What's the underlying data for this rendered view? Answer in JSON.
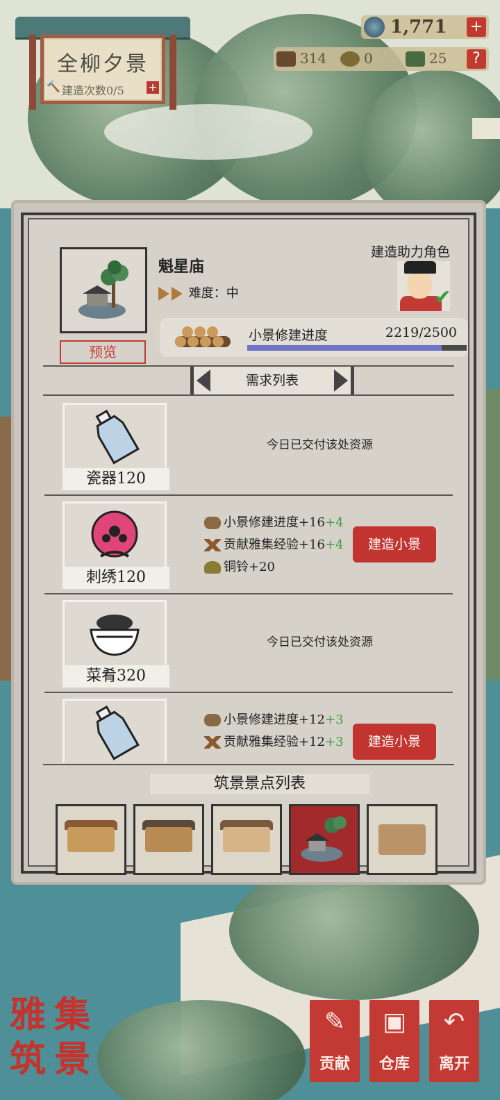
{
  "location": {
    "title": "全柳夕景",
    "build_count": "建造次数0/5"
  },
  "currency": {
    "coins": "1,771",
    "wood": "314",
    "bell": "0",
    "jade": "25",
    "add_symbol": "+",
    "help_symbol": "?"
  },
  "building": {
    "name": "魁星庙",
    "difficulty": "难度：中",
    "preview": "预览",
    "helper_label": "建造助力角色",
    "progress_label": "小景修建进度",
    "progress_value": "2219/2500",
    "progress_fraction": 0.8876
  },
  "requirements": {
    "header": "需求列表",
    "items": [
      {
        "name": "瓷器120",
        "status": "今日已交付该处资源"
      },
      {
        "name": "刺绣120",
        "reward1": "小景修建进度+16",
        "bonus1": "+4",
        "reward2": "贡献雅集经验+16",
        "bonus2": "+4",
        "reward3": "铜铃+20",
        "action": "建造小景"
      },
      {
        "name": "菜肴320",
        "status": "今日已交付该处资源"
      },
      {
        "name": "",
        "reward1": "小景修建进度+12",
        "bonus1": "+3",
        "reward2": "贡献雅集经验+12",
        "bonus2": "+3",
        "action": "建造小景"
      }
    ]
  },
  "sites": {
    "header": "筑景景点列表"
  },
  "logo": {
    "c1": "雅",
    "c2": "集",
    "c3": "筑",
    "c4": "景"
  },
  "bottom": {
    "contribute": "贡献",
    "warehouse": "仓库",
    "leave": "离开"
  }
}
